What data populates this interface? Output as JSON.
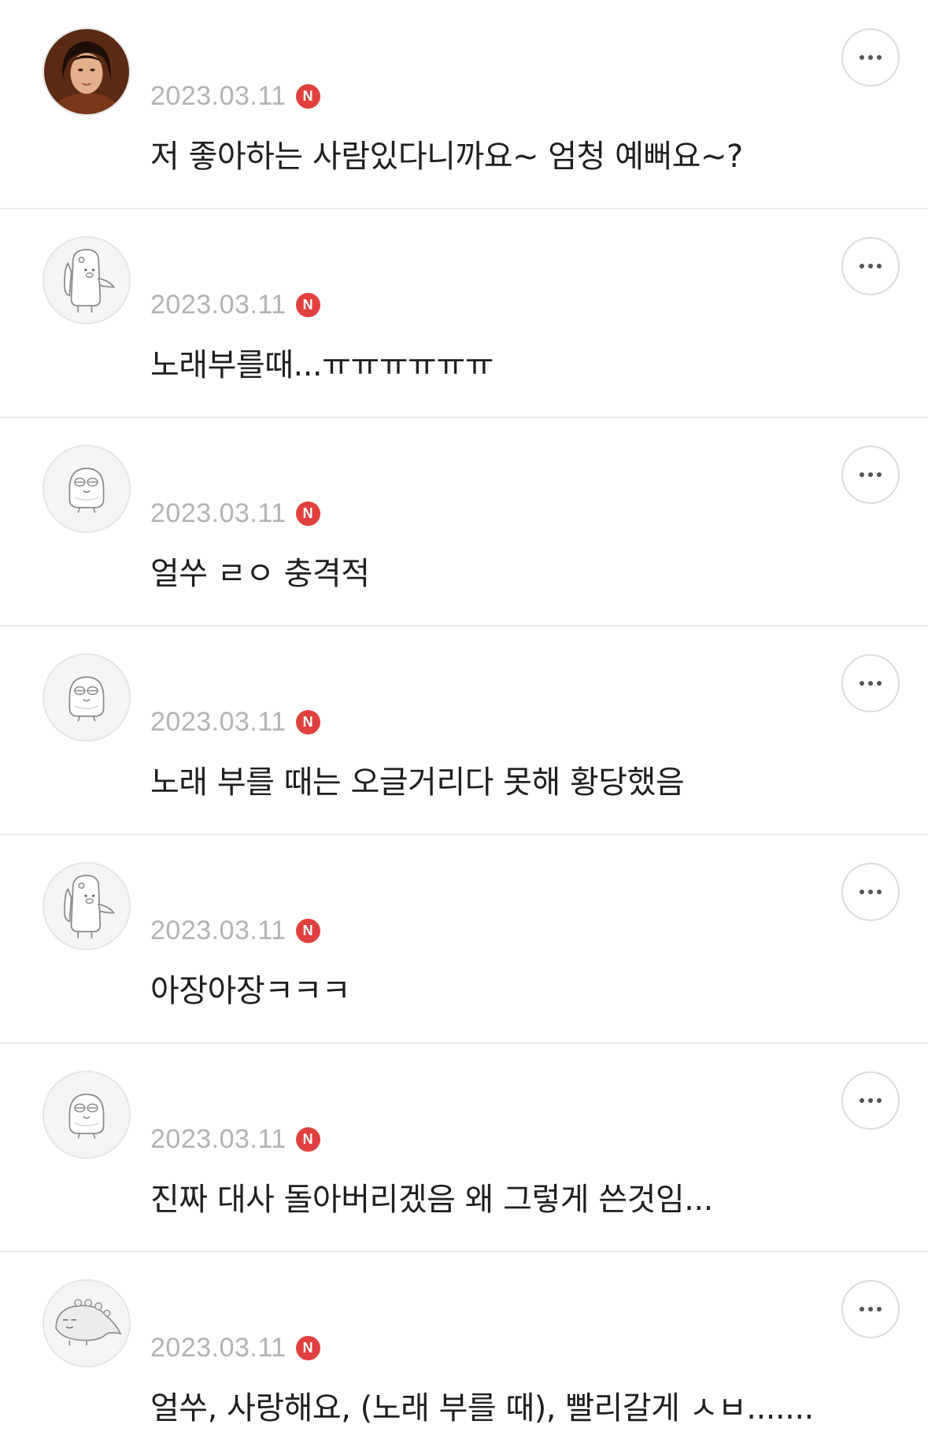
{
  "comments": [
    {
      "avatar": "portrait-photo-avatar",
      "nickname": "",
      "date": "2023.03.11",
      "badge": "N",
      "text": "저 좋아하는 사람있다니까요~ 엄청 예뻐요~?"
    },
    {
      "avatar": "waving-character-avatar",
      "nickname": "",
      "date": "2023.03.11",
      "badge": "N",
      "text": "노래부를때...ㅠㅠㅠㅠㅠㅠ"
    },
    {
      "avatar": "round-character-avatar",
      "nickname": "",
      "date": "2023.03.11",
      "badge": "N",
      "text": "얼쑤 ㄹㅇ 충격적"
    },
    {
      "avatar": "round-character-avatar",
      "nickname": "",
      "date": "2023.03.11",
      "badge": "N",
      "text": "노래 부를 때는 오글거리다 못해 황당했음"
    },
    {
      "avatar": "waving-character-avatar",
      "nickname": "",
      "date": "2023.03.11",
      "badge": "N",
      "text": "아장아장ㅋㅋㅋ"
    },
    {
      "avatar": "round-character-avatar",
      "nickname": "",
      "date": "2023.03.11",
      "badge": "N",
      "text": "진짜 대사 돌아버리겠음 왜 그렇게 쓴것임..."
    },
    {
      "avatar": "lizard-character-avatar",
      "nickname": "",
      "date": "2023.03.11",
      "badge": "N",
      "text": "얼쑤, 사랑해요, (노래 부를 때), 빨리갈게 ㅅㅂ......."
    }
  ],
  "colors": {
    "badge": "#e0413f",
    "date": "#b3b3b3",
    "text": "#1f1f1f",
    "divider": "#ebebeb"
  },
  "icons": {
    "more": "more-options-icon",
    "badge": "new-badge-icon"
  }
}
